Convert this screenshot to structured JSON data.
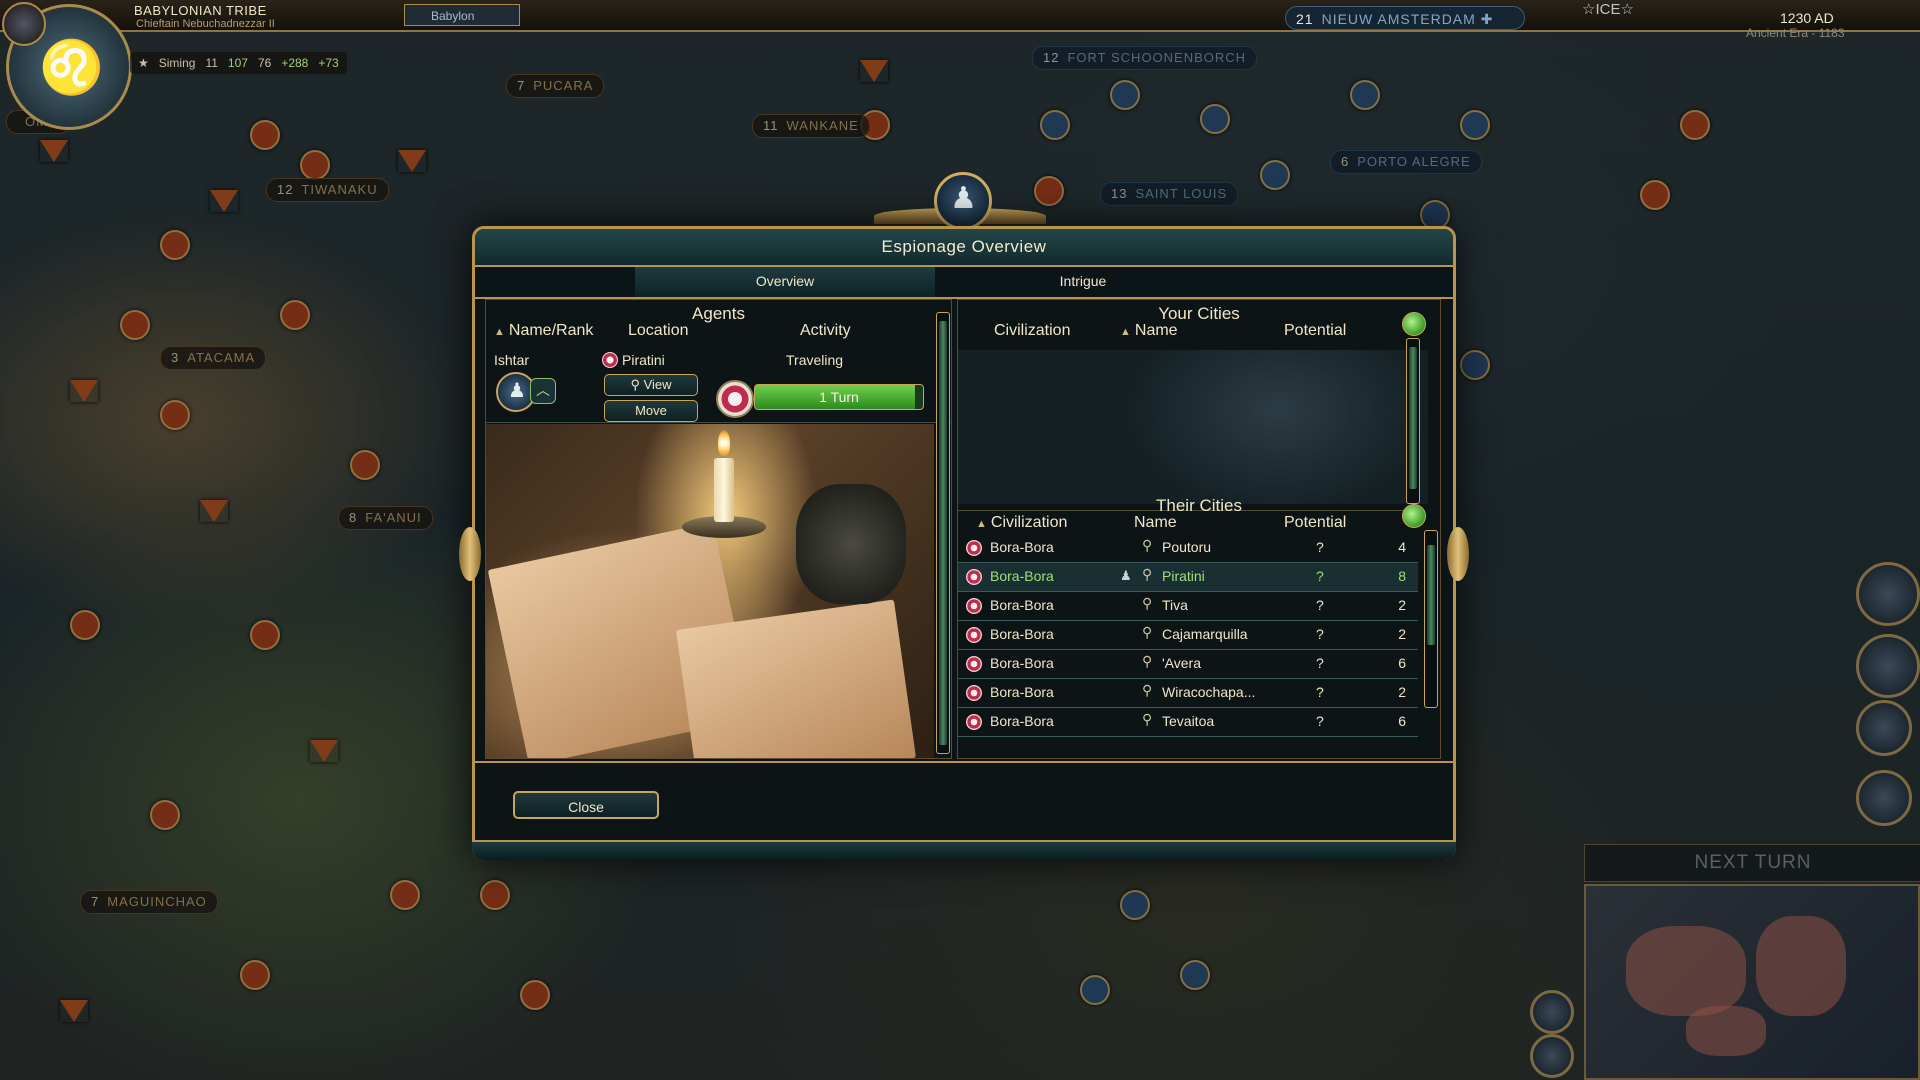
{
  "hud": {
    "tribe": "BABYLONIAN TRIBE",
    "leader": "Chieftain Nebuchadnezzar II",
    "capital": "Babylon",
    "stats": {
      "era_label": "Siming",
      "science": "11",
      "gold": "107",
      "faith": "76",
      "gold_rate": "+288",
      "culture_rate": "+73"
    },
    "top_city": {
      "size": "21",
      "name": "NIEUW AMSTERDAM"
    },
    "ice_label": "ICE",
    "date": "1230 AD",
    "era_turn": "Ancient Era - 1183"
  },
  "map": {
    "city_labels": [
      {
        "size": "12",
        "name": "FORT SCHOONENBORCH",
        "style": "blue"
      },
      {
        "size": "7",
        "name": "PUCARA",
        "style": "brown"
      },
      {
        "size": "11",
        "name": "WANKANE",
        "style": "brown"
      },
      {
        "size": "12",
        "name": "TIWANAKU",
        "style": "brown"
      },
      {
        "size": "6",
        "name": "PORTO ALEGRE",
        "style": "blue"
      },
      {
        "size": "13",
        "name": "SAINT LOUIS",
        "style": "blue"
      },
      {
        "size": "3",
        "name": "ATACAMA",
        "style": "brown"
      },
      {
        "size": "8",
        "name": "FA'ANUI",
        "style": "brown"
      },
      {
        "size": "7",
        "name": "MAGUINCHAO",
        "style": "brown"
      },
      {
        "size": "",
        "name": "OMO",
        "style": "brown"
      }
    ]
  },
  "dialog": {
    "title": "Espionage Overview",
    "tabs": [
      {
        "label": "Overview"
      },
      {
        "label": "Intrigue"
      }
    ],
    "agents": {
      "title": "Agents",
      "col_name": "Name/Rank",
      "col_location": "Location",
      "col_activity": "Activity",
      "agent": {
        "name": "Ishtar",
        "location": "Piratini",
        "activity": "Traveling",
        "progress_label": "1 Turn",
        "progress_fraction": 0.95,
        "view_label": "View",
        "move_label": "Move"
      }
    },
    "your_cities": {
      "title": "Your Cities",
      "col_civ": "Civilization",
      "col_name": "Name",
      "col_potential": "Potential"
    },
    "their_cities": {
      "title": "Their Cities",
      "col_civ": "Civilization",
      "col_name": "Name",
      "col_potential": "Potential",
      "rows": [
        {
          "civ": "Bora-Bora",
          "name": "Poutoru",
          "q": "?",
          "potential": "4",
          "highlight": false
        },
        {
          "civ": "Bora-Bora",
          "name": "Piratini",
          "q": "?",
          "potential": "8",
          "highlight": true
        },
        {
          "civ": "Bora-Bora",
          "name": "Tiva",
          "q": "?",
          "potential": "2",
          "highlight": false
        },
        {
          "civ": "Bora-Bora",
          "name": "Cajamarquilla",
          "q": "?",
          "potential": "2",
          "highlight": false
        },
        {
          "civ": "Bora-Bora",
          "name": "'Avera",
          "q": "?",
          "potential": "6",
          "highlight": false
        },
        {
          "civ": "Bora-Bora",
          "name": "Wiracochapa...",
          "q": "?",
          "potential": "2",
          "highlight": false
        },
        {
          "civ": "Bora-Bora",
          "name": "Tevaitoa",
          "q": "?",
          "potential": "6",
          "highlight": false
        }
      ]
    },
    "close_label": "Close"
  },
  "next_turn": "NEXT TURN",
  "colors": {
    "gold_trim": "#b8944e",
    "panel_teal": "#234548",
    "progress_green": "#6fd04a",
    "highlight_text": "#9fe07a"
  }
}
